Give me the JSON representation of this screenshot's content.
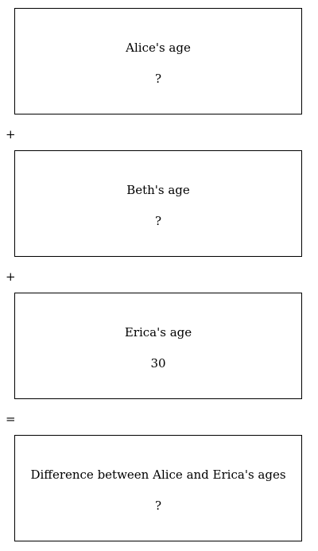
{
  "boxes": [
    {
      "label": "Alice's age",
      "value": "?"
    },
    {
      "label": "Beth's age",
      "value": "?"
    },
    {
      "label": "Erica's age",
      "value": "30"
    },
    {
      "label": "Difference between Alice and Erica's ages",
      "value": "?"
    }
  ],
  "operators": [
    "+",
    "+",
    "="
  ]
}
